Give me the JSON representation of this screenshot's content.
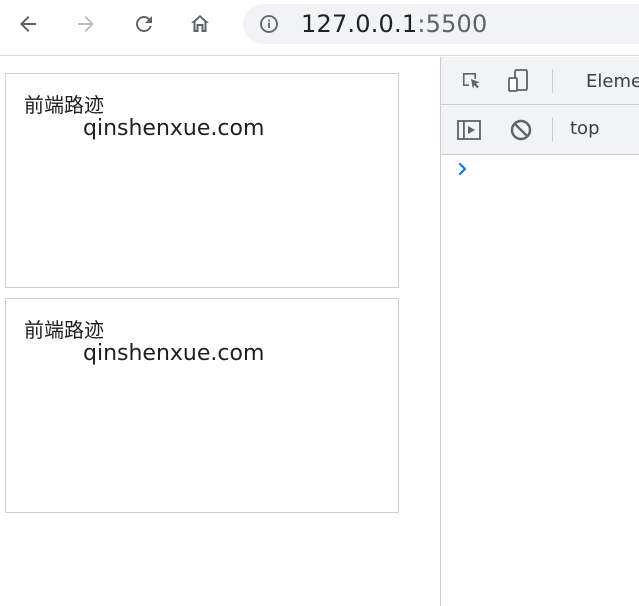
{
  "browser": {
    "url_host": "127.0.0.1",
    "url_port": ":5500",
    "back_icon": "arrow-left-icon",
    "forward_icon": "arrow-right-icon",
    "reload_icon": "reload-icon",
    "home_icon": "home-icon",
    "info_icon": "info-icon"
  },
  "page": {
    "boxes": [
      {
        "title": "前端路迹",
        "subtitle": "qinshenxue.com"
      },
      {
        "title": "前端路迹",
        "subtitle": "qinshenxue.com"
      }
    ]
  },
  "devtools": {
    "tabs": {
      "elements_label": "Eleme"
    },
    "console": {
      "context_label": "top",
      "prompt_symbol": "›"
    },
    "colors": {
      "toolbar_bg": "#f1f3f4",
      "prompt": "#1a73e8"
    }
  }
}
